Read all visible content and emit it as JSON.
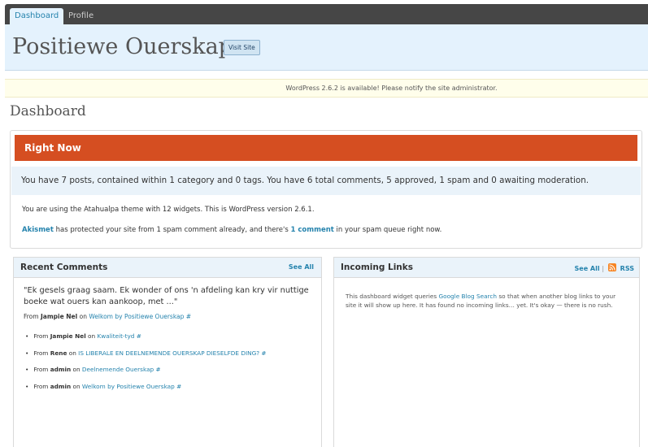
{
  "tabs": [
    {
      "label": "Dashboard",
      "active": true
    },
    {
      "label": "Profile",
      "active": false
    }
  ],
  "site": {
    "title": "Positiewe Ouerskap",
    "visit_site_label": "Visit Site"
  },
  "update_nag": "WordPress 2.6.2 is available! Please notify the site administrator.",
  "page_title": "Dashboard",
  "right_now": {
    "heading": "Right Now",
    "summary": "You have 7 posts, contained within 1 category and 0 tags. You have 6 total comments, 5 approved, 1 spam and 0 awaiting moderation.",
    "theme_line": "You are using the Atahualpa theme with 12 widgets. This is WordPress version 2.6.1.",
    "akismet_link": "Akismet",
    "akismet_text_1": " has protected your site from 1 spam comment already, and there's ",
    "akismet_comment_link": "1 comment",
    "akismet_text_2": " in your spam queue right now."
  },
  "recent_comments": {
    "title": "Recent Comments",
    "see_all": "See All",
    "quote": "\"Ek gesels graag saam. Ek wonder of ons 'n afdeling kan kry vir nuttige boeke wat ouers kan aankoop, met ...\"",
    "latest": {
      "prefix": "From ",
      "author": "Jampie Nel",
      "on": " on ",
      "post": "Welkom by Positiewe Ouerskap #"
    },
    "items": [
      {
        "prefix": "From ",
        "author": "Jampie Nel",
        "on": " on ",
        "post": "Kwaliteit-tyd #"
      },
      {
        "prefix": "From ",
        "author": "Rene",
        "on": " on ",
        "post": "IS LIBERALE EN DEELNEMENDE OUERSKAP DIESELFDE DING? #"
      },
      {
        "prefix": "From ",
        "author": "admin",
        "on": " on ",
        "post": "Deelnemende Ouerskap #"
      },
      {
        "prefix": "From ",
        "author": "admin",
        "on": " on ",
        "post": "Welkom by Positiewe Ouerskap #"
      }
    ]
  },
  "incoming_links": {
    "title": "Incoming Links",
    "see_all": "See All",
    "separator": "|",
    "rss_label": "RSS",
    "text_1": "This dashboard widget queries ",
    "link": "Google Blog Search",
    "text_2": " so that when another blog links to your site it will show up here. It has found no incoming links… yet. It's okay — there is no rush."
  },
  "colors": {
    "right_now_header": "#d54e21",
    "header_bg": "#e4f2fd",
    "link": "#2583ad",
    "topbar": "#464646",
    "rss": "#f78422"
  },
  "icons": {
    "rss": "rss-feed-icon"
  }
}
